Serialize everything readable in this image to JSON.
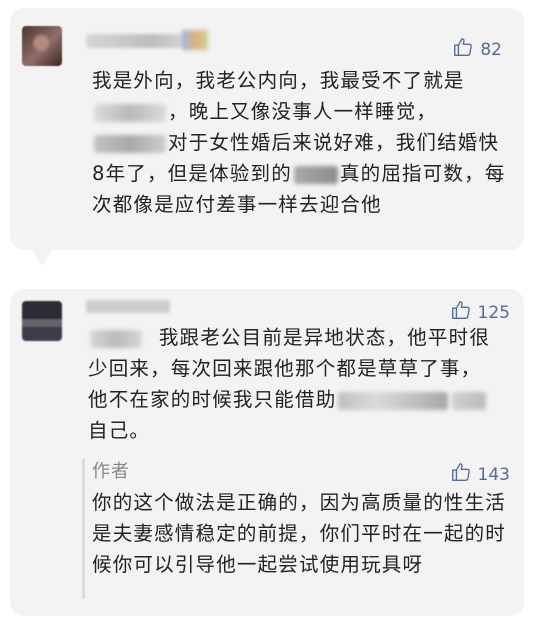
{
  "comments": [
    {
      "likes": "82",
      "text_part1": "我是外向，我老公内向，我最受不了就是",
      "blur1": "冷暴力",
      "text_part2": "，晚上又像没事人一样睡觉，",
      "blur2": "性生活",
      "text_part3": "对于女性婚后来说好难，我们结婚快8年了，但是体验到的",
      "blur3": "高潮",
      "text_part4": "真的屈指可数，每次都像是应付差事一样去迎合他"
    },
    {
      "likes": "125",
      "text_part1": "我跟老公目前是异地状态，他平时很少回来，每次回来跟他那个都是草草了事，他不在家的时候我只能借助",
      "text_part2": "自己。"
    }
  ],
  "reply": {
    "author_label": "作者",
    "likes": "143",
    "text": "你的这个做法是正确的，因为高质量的性生活是夫妻感情稳定的前提，你们平时在一起的时候你可以引导他一起尝试使用玩具呀"
  },
  "colors": {
    "card_bg": "#f3f3f3",
    "like_blue": "#576b95",
    "text_dark": "#222222",
    "author_gray": "#888888"
  },
  "icons": [
    "thumbs-up-icon"
  ]
}
